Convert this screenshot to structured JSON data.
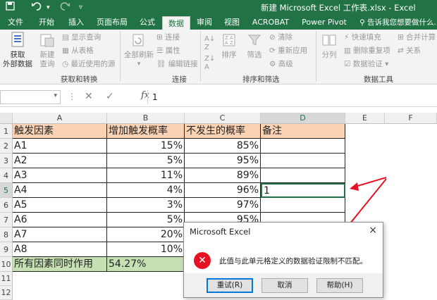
{
  "app": {
    "title": "新建 Microsoft Excel 工作表.xlsx - Excel",
    "accent": "#217346",
    "quick_access": [
      "save-icon",
      "undo-icon",
      "redo-icon",
      "customize-icon"
    ]
  },
  "tabs": [
    {
      "label": "文件"
    },
    {
      "label": "开始"
    },
    {
      "label": "插入"
    },
    {
      "label": "页面布局"
    },
    {
      "label": "公式"
    },
    {
      "label": "数据",
      "active": true
    },
    {
      "label": "审阅"
    },
    {
      "label": "视图"
    },
    {
      "label": "ACROBAT"
    },
    {
      "label": "Power Pivot"
    }
  ],
  "tell_me": "告诉我您想要做什么...",
  "ribbon": {
    "get_external": {
      "label_line1": "获取",
      "label_line2": "外部数据"
    },
    "new_query": {
      "label_line1": "新建",
      "label_line2": "查询"
    },
    "show_queries": "显示查询",
    "from_table": "从表格",
    "recent_sources": "最近使用的源",
    "group1": "获取和转换",
    "refresh_all": {
      "label_line1": "全部刷新"
    },
    "connections": "连接",
    "properties": "属性",
    "edit_links": "编辑链接",
    "group2": "连接",
    "sort": "排序",
    "filter": "筛选",
    "clear": "清除",
    "reapply": "重新应用",
    "advanced": "高级",
    "group3": "排序和筛选",
    "text_to_columns": "分列",
    "flash_fill": "快速填充",
    "remove_duplicates": "删除重复项",
    "data_validation": "数据验证",
    "consolidate": "合并计算",
    "relationships": "关系",
    "group4": "数据工具"
  },
  "formula_bar": {
    "name_box": "",
    "value": "1",
    "fx": "fx"
  },
  "columns": [
    "A",
    "B",
    "C",
    "D",
    "E",
    "F"
  ],
  "rows": [
    "1",
    "2",
    "3",
    "4",
    "5",
    "6",
    "7",
    "8",
    "9",
    "10",
    "11",
    "12"
  ],
  "table": {
    "header": [
      "触发因素",
      "增加触发概率",
      "不发生的概率",
      "备注"
    ],
    "data": [
      [
        "A1",
        "15%",
        "85%",
        ""
      ],
      [
        "A2",
        "5%",
        "95%",
        ""
      ],
      [
        "A3",
        "11%",
        "89%",
        ""
      ],
      [
        "A4",
        "4%",
        "96%",
        "1"
      ],
      [
        "A5",
        "3%",
        "97%",
        ""
      ],
      [
        "A6",
        "5%",
        "95%",
        ""
      ],
      [
        "A7",
        "20%",
        "",
        ""
      ],
      [
        "A8",
        "10%",
        "",
        ""
      ]
    ],
    "summary": [
      "所有因素同时作用",
      "54.27%"
    ]
  },
  "colors": {
    "header_fill": "#fbd3b4",
    "summary_fill": "#c6e0b4",
    "arrow": "#e81123"
  },
  "dialog": {
    "title": "Microsoft Excel",
    "close": "×",
    "icon": "error-icon",
    "message": "此值与此单元格定义的数据验证限制不匹配。",
    "buttons": [
      "重试(R)",
      "取消",
      "帮助(H)"
    ]
  }
}
